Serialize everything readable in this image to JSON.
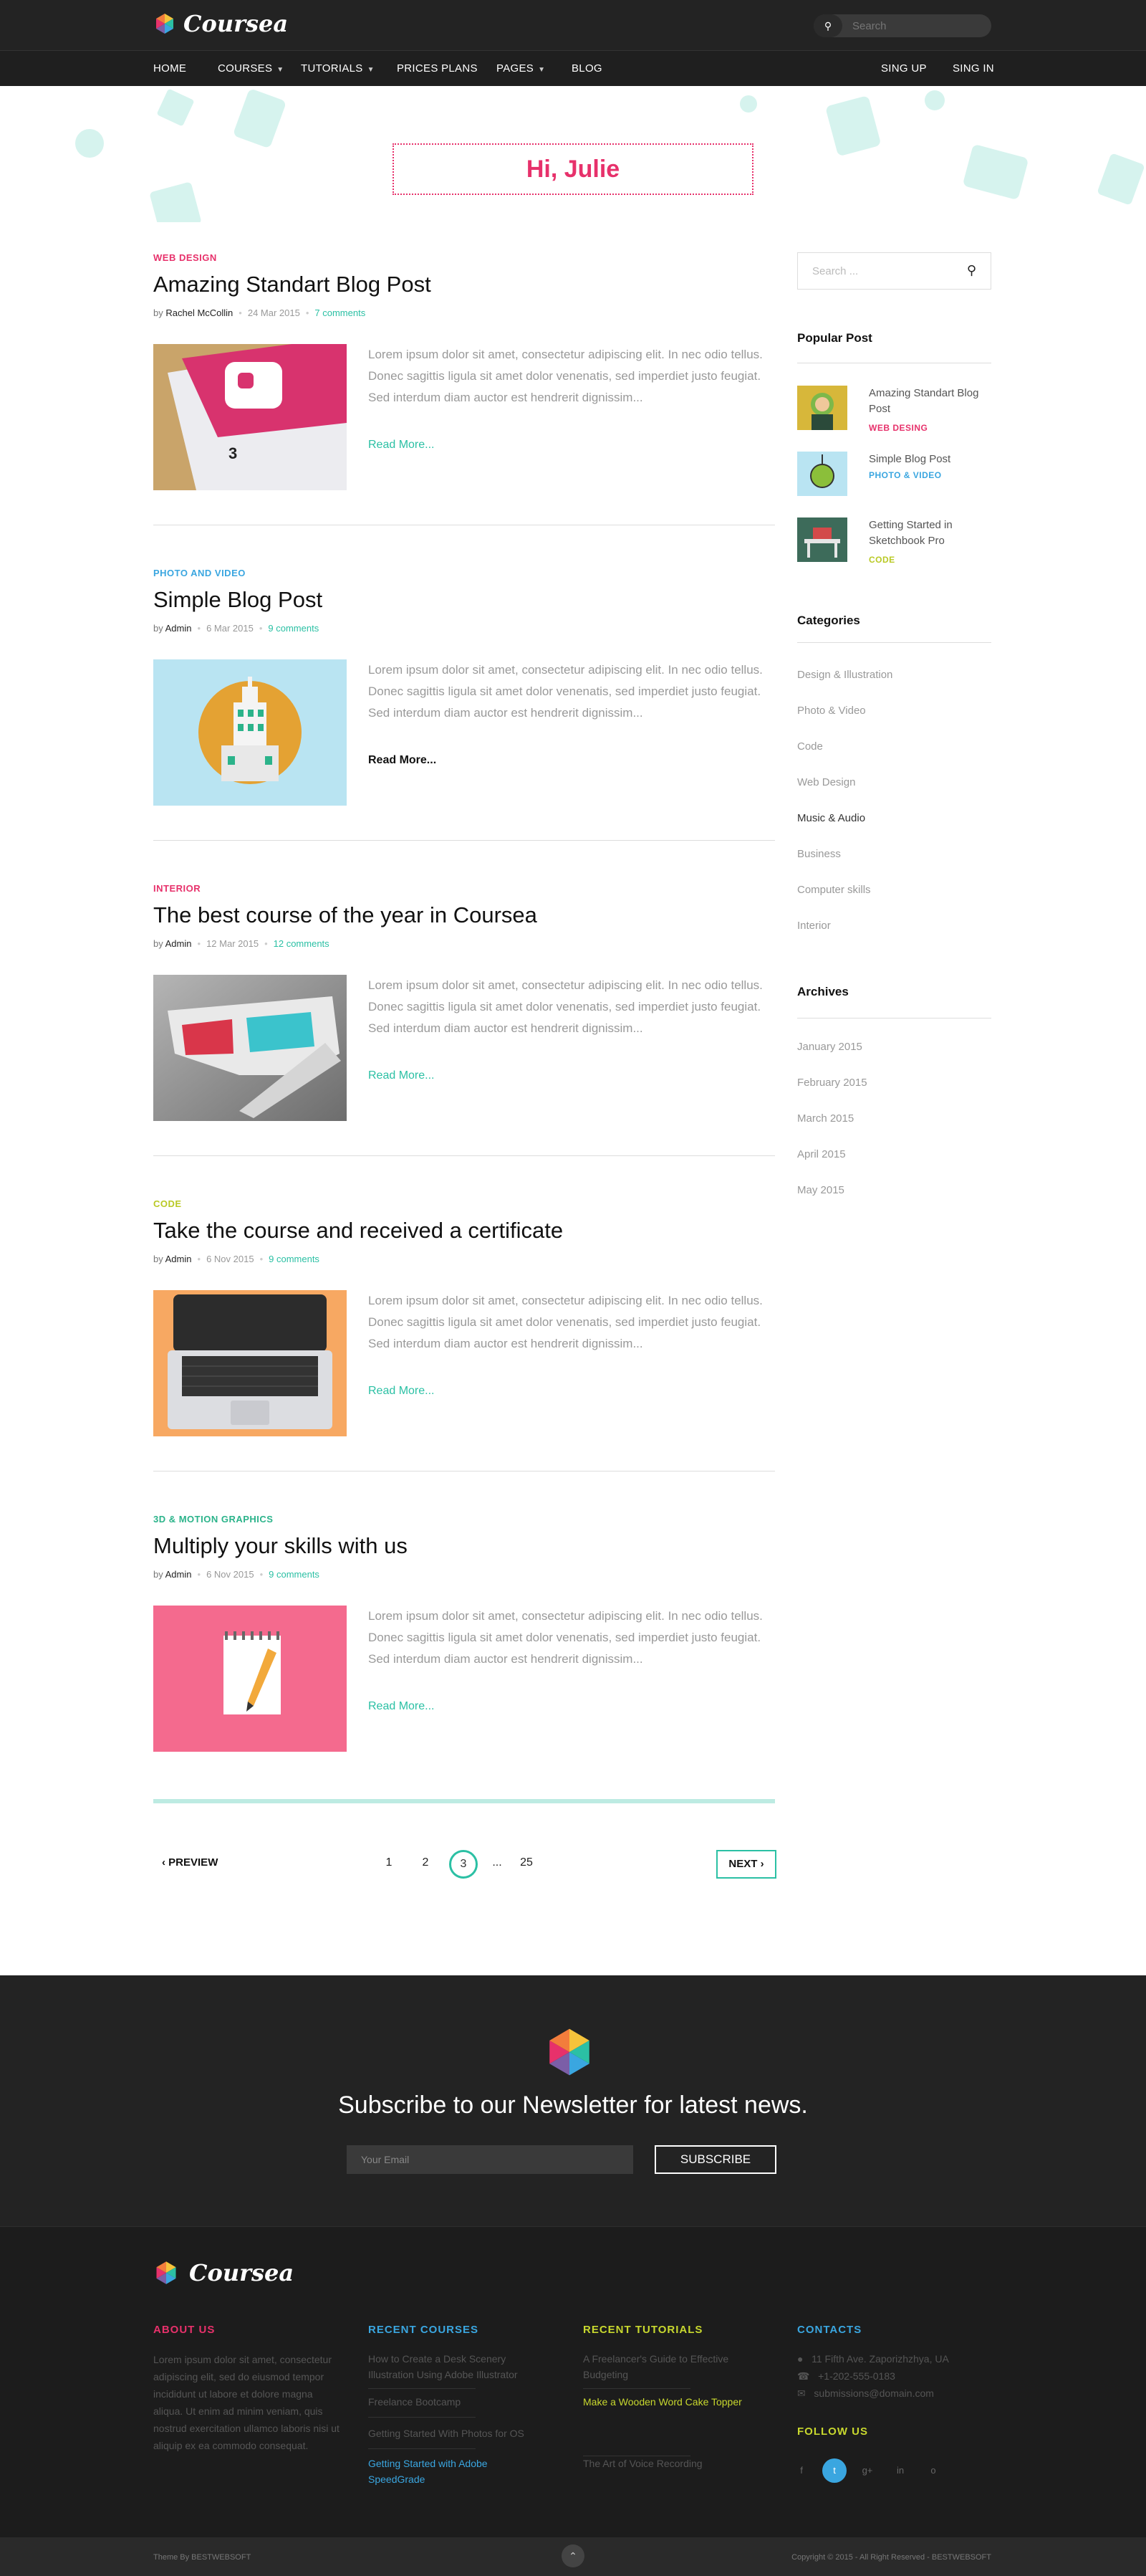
{
  "header": {
    "logo_text": "Coursea",
    "search_placeholder": "Search"
  },
  "nav": {
    "left": [
      {
        "label": "HOME",
        "dropdown": false
      },
      {
        "label": "COURSES",
        "dropdown": true
      },
      {
        "label": "TUTORIALS",
        "dropdown": true
      },
      {
        "label": "PRICES PLANS",
        "dropdown": false
      },
      {
        "label": "PAGES",
        "dropdown": true
      },
      {
        "label": "BLOG",
        "dropdown": false
      }
    ],
    "right": [
      {
        "label": "SING UP"
      },
      {
        "label": "SING IN"
      }
    ]
  },
  "greeting": "Hi, Julie",
  "posts": [
    {
      "category": "WEB DESIGN",
      "category_color": "#e7316b",
      "title": "Amazing Standart Blog Post",
      "by": "by",
      "author": "Rachel McCollin",
      "date": "24 Mar 2015",
      "comments": "7 comments",
      "excerpt": "Lorem ipsum dolor sit amet, consectetur adipiscing elit. In nec odio tellus. Donec sagittis ligula sit amet dolor venenatis, sed imperdiet justo feugiat. Sed interdum diam auctor est hendrerit dignissim...",
      "read_more": "Read More...",
      "read_more_color": "#2bc0a4",
      "thumb": "pink-book"
    },
    {
      "category": "PHOTO AND VIDEO",
      "category_color": "#3aa6e0",
      "title": "Simple Blog Post",
      "by": "by",
      "author": "Admin",
      "date": "6 Mar 2015",
      "comments": "9 comments",
      "excerpt": "Lorem ipsum dolor sit amet, consectetur adipiscing elit. In nec odio tellus. Donec sagittis ligula sit amet dolor venenatis, sed imperdiet justo feugiat. Sed interdum diam auctor est hendrerit dignissim...",
      "read_more": "Read More...",
      "read_more_color": "#111111",
      "thumb": "building"
    },
    {
      "category": "INTERIOR",
      "category_color": "#e7316b",
      "title": "The best course of the year in Coursea",
      "by": "by",
      "author": "Admin",
      "date": "12 Mar 2015",
      "comments": "12 comments",
      "excerpt": "Lorem ipsum dolor sit amet, consectetur adipiscing elit. In nec odio tellus. Donec sagittis ligula sit amet dolor venenatis, sed imperdiet justo feugiat. Sed interdum diam auctor est hendrerit dignissim...",
      "read_more": "Read More...",
      "read_more_color": "#2bc0a4",
      "thumb": "glasses"
    },
    {
      "category": "CODE",
      "category_color": "#b9c924",
      "title": "Take the course and received a certificate",
      "by": "by",
      "author": "Admin",
      "date": "6 Nov 2015",
      "comments": "9 comments",
      "excerpt": "Lorem ipsum dolor sit amet, consectetur adipiscing elit. In nec odio tellus. Donec sagittis ligula sit amet dolor venenatis, sed imperdiet justo feugiat. Sed interdum diam auctor est hendrerit dignissim...",
      "read_more": "Read More...",
      "read_more_color": "#2bc0a4",
      "thumb": "laptop"
    },
    {
      "category": "3D & MOTION GRAPHICS",
      "category_color": "#2bb38a",
      "title": "Multiply your skills with us",
      "by": "by",
      "author": "Admin",
      "date": "6 Nov 2015",
      "comments": "9 comments",
      "excerpt": "Lorem ipsum dolor sit amet, consectetur adipiscing elit. In nec odio tellus. Donec sagittis ligula sit amet dolor venenatis, sed imperdiet justo feugiat. Sed interdum diam auctor est hendrerit dignissim...",
      "read_more": "Read More...",
      "read_more_color": "#2bc0a4",
      "thumb": "notepad"
    }
  ],
  "pagination": {
    "prev": "PREVIEW",
    "pages": [
      "1",
      "2",
      "3",
      "...",
      "25"
    ],
    "current": "3",
    "next": "NEXT"
  },
  "sidebar": {
    "search_placeholder": "Search ...",
    "popular_title": "Popular  Post",
    "popular": [
      {
        "title": "Amazing Standart Blog Post",
        "category": "WEB DESING",
        "color": "#e7316b"
      },
      {
        "title": "Simple Blog Post",
        "category": "PHOTO & VIDEO",
        "color": "#3aa6e0"
      },
      {
        "title": "Getting Started in Sketchbook Pro",
        "category": "CODE",
        "color": "#b9c924"
      }
    ],
    "categories_title": "Categories",
    "categories": [
      "Design & Illustration",
      "Photo & Video",
      "Code",
      "Web Design",
      "Music & Audio",
      "Business",
      "Computer skills",
      "Interior"
    ],
    "archives_title": "Archives",
    "archives": [
      "January 2015",
      "February 2015",
      "March 2015",
      "April 2015",
      "May 2015"
    ]
  },
  "newsletter": {
    "heading": "Subscribe to our Newsletter for latest news.",
    "email_placeholder": "Your Email",
    "button": "SUBSCRIBE"
  },
  "footer": {
    "logo_text": "Coursea",
    "about": {
      "title": "ABOUT US",
      "color": "#e7316b",
      "text": "Lorem ipsum dolor sit amet, consectetur adipiscing elit, sed do eiusmod tempor incididunt ut labore et dolore magna aliqua. Ut enim ad minim veniam, quis nostrud exercitation ullamco laboris nisi ut aliquip ex ea commodo consequat."
    },
    "courses": {
      "title": "RECENT  COURSES",
      "color": "#3aa6e0",
      "items": [
        "How to Create a Desk Scenery Illustration Using Adobe Illustrator",
        "Freelance Bootcamp",
        "Getting Started With Photos for OS",
        "Getting Started with Adobe SpeedGrade"
      ]
    },
    "tutorials": {
      "title": "RECENT  TUTORIALS",
      "color": "#c8d82e",
      "items": [
        "A Freelancer's Guide to Effective Budgeting",
        "Make a Wooden Word Cake Topper",
        "The Art of Voice Recording"
      ]
    },
    "contacts": {
      "title": "CONTACTS",
      "color": "#3aa6e0",
      "address": "11 Fifth Ave.  Zaporizhzhya, UA",
      "phone": "+1-202-555-0183",
      "email": "submissions@domain.com"
    },
    "follow_title": "FOLLOW US",
    "follow_color": "#c8d82e",
    "social": [
      "f",
      "t",
      "g+",
      "in",
      "o"
    ],
    "theme_by": "Theme By BESTWEBSOFT",
    "copyright": "Copyright © 2015 - All Right Reserved - BESTWEBSOFT"
  }
}
